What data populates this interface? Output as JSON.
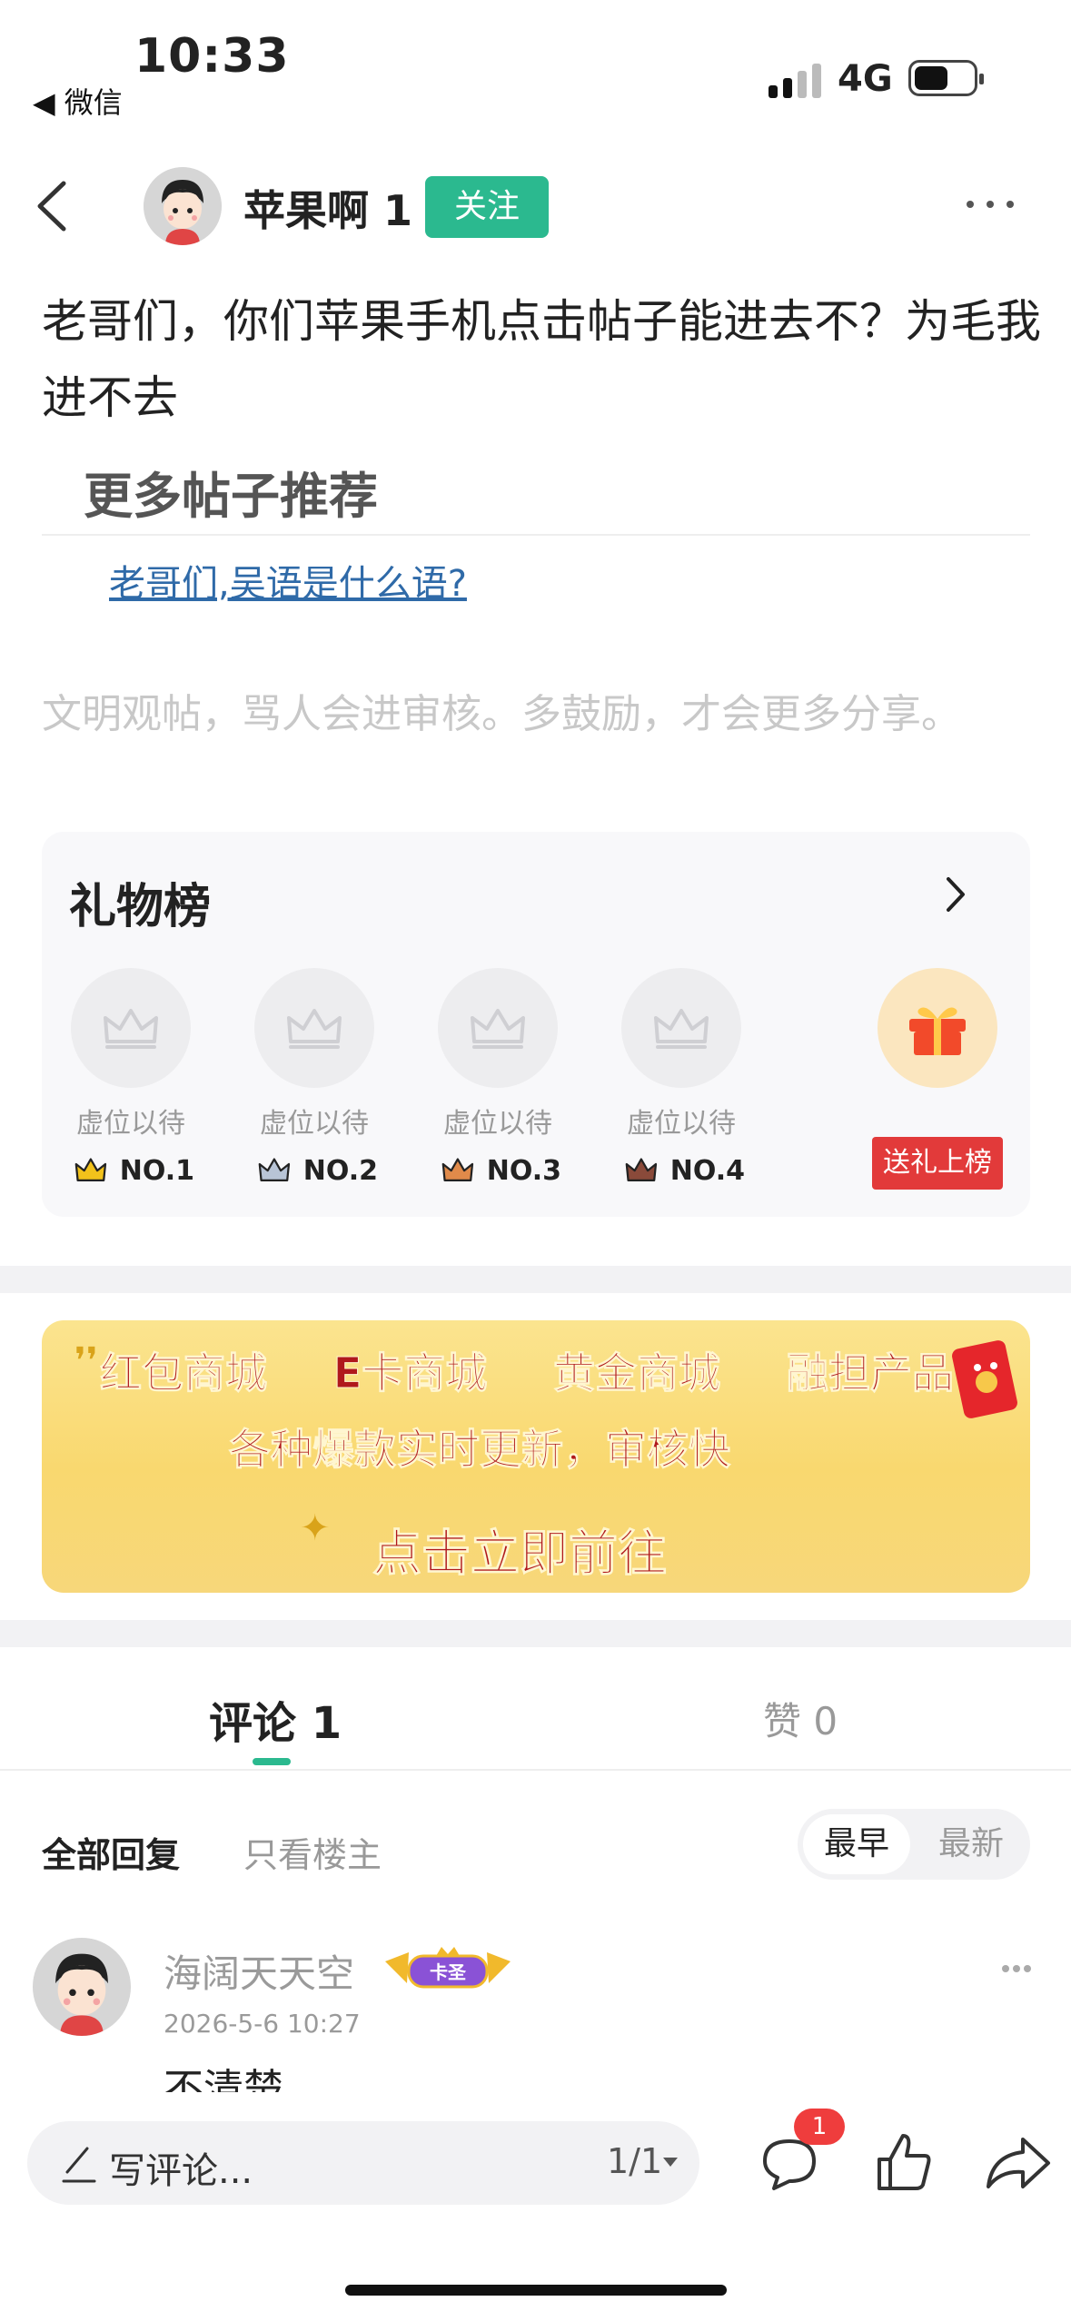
{
  "status_bar": {
    "time": "10:33",
    "back_app": "◀ 微信",
    "network": "4G"
  },
  "header": {
    "author": "苹果啊 1",
    "follow_label": "关注"
  },
  "post": {
    "title": "老哥们，你们苹果手机点击帖子能进去不？为毛我进不去",
    "more_posts_heading": "更多帖子推荐",
    "recommended_link": "老哥们,吴语是什么语?",
    "civility_note": "文明观帖，骂人会进审核。多鼓励，才会更多分享。"
  },
  "gift_board": {
    "title": "礼物榜",
    "slots": [
      {
        "caption": "虚位以待",
        "rank": "NO.1",
        "crown_color": "#f2c21b"
      },
      {
        "caption": "虚位以待",
        "rank": "NO.2",
        "crown_color": "#b8c4d6"
      },
      {
        "caption": "虚位以待",
        "rank": "NO.3",
        "crown_color": "#e08a4a"
      },
      {
        "caption": "虚位以待",
        "rank": "NO.4",
        "crown_color": "#8a4a3a"
      }
    ],
    "send_label": "送礼上榜"
  },
  "banner": {
    "items": [
      "红包商城",
      "E卡商城",
      "黄金商城",
      "融担产品"
    ],
    "line2": "各种爆款实时更新，审核快",
    "cta": "点击立即前往"
  },
  "tabs": {
    "comments": "评论 1",
    "likes": "赞 0"
  },
  "filters": {
    "all": "全部回复",
    "op_only": "只看楼主",
    "sort_early": "最早",
    "sort_new": "最新"
  },
  "comment": {
    "name": "海阔天天空",
    "badge": "卡圣",
    "time": "2026-5-6 10:27",
    "text": "不清楚"
  },
  "bottom_bar": {
    "placeholder": "写评论...",
    "page": "1/1",
    "comment_count": "1"
  },
  "colors": {
    "accent": "#2bb98f",
    "red": "#e23a3a",
    "link": "#2f6aa8"
  }
}
